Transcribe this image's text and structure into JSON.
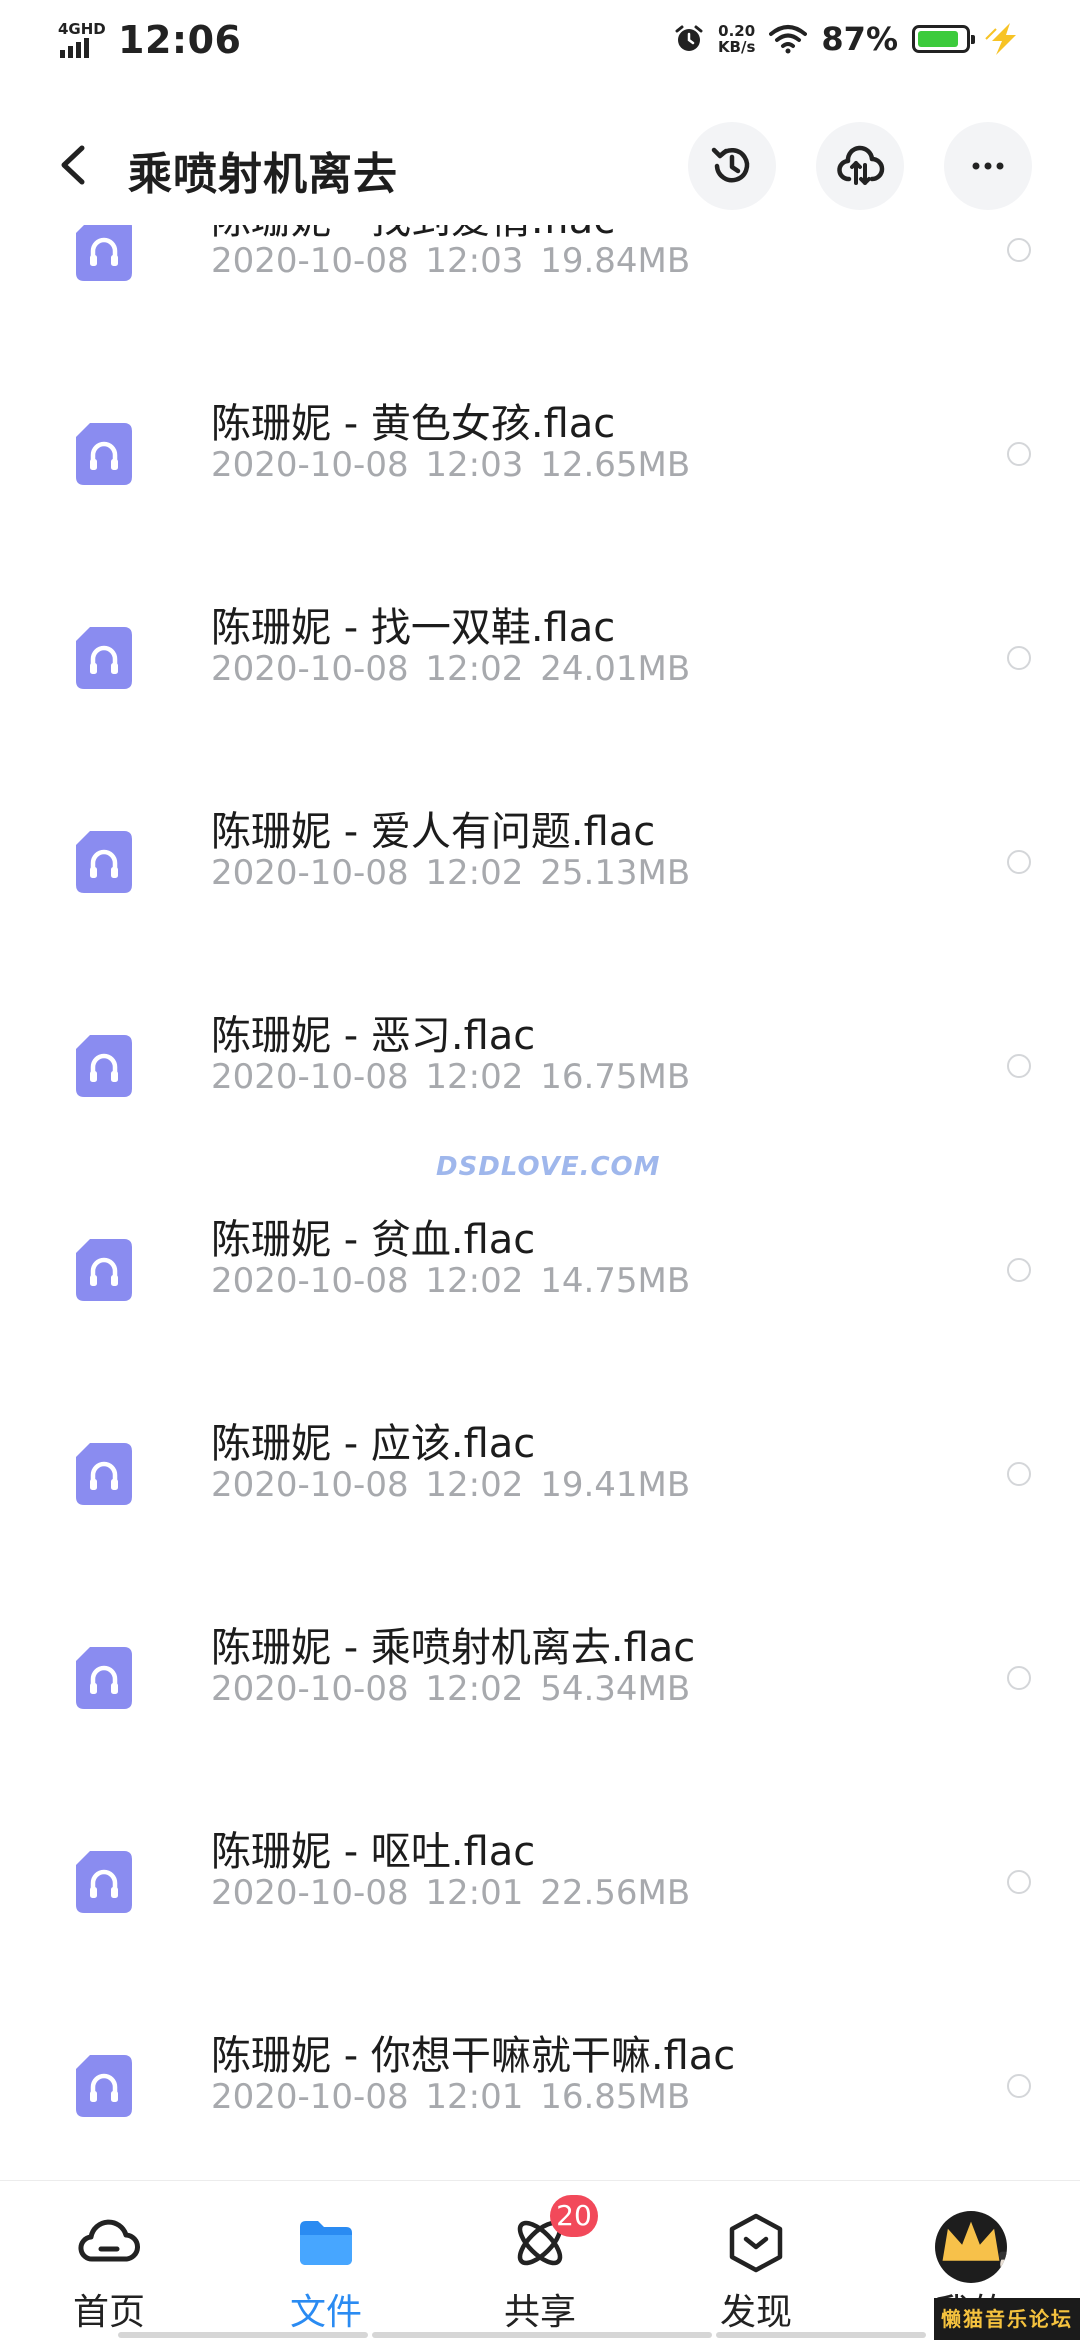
{
  "status_bar": {
    "network_type": "4GHD",
    "time": "12:06",
    "net_speed_value": "0.20",
    "net_speed_unit": "KB/s",
    "battery_percent": "87%",
    "battery_level": 0.87,
    "battery_color": "#3ccb3c"
  },
  "header": {
    "title": "乘喷射机离去",
    "back_icon": "chevron-left-icon",
    "actions": [
      "history-icon",
      "cloud-transfer-icon",
      "more-icon"
    ]
  },
  "files": [
    {
      "name": "陈珊妮 - 找到爱情.flac",
      "meta": "2020-10-08 12:03 19.84MB"
    },
    {
      "name": "陈珊妮 - 黄色女孩.flac",
      "meta": "2020-10-08 12:03 12.65MB"
    },
    {
      "name": "陈珊妮 - 找一双鞋.flac",
      "meta": "2020-10-08 12:02 24.01MB"
    },
    {
      "name": "陈珊妮 - 爱人有问题.flac",
      "meta": "2020-10-08 12:02 25.13MB"
    },
    {
      "name": "陈珊妮 - 恶习.flac",
      "meta": "2020-10-08 12:02 16.75MB"
    },
    {
      "name": "陈珊妮 - 贫血.flac",
      "meta": "2020-10-08 12:02 14.75MB"
    },
    {
      "name": "陈珊妮 - 应该.flac",
      "meta": "2020-10-08 12:02 19.41MB"
    },
    {
      "name": "陈珊妮 - 乘喷射机离去.flac",
      "meta": "2020-10-08 12:02 54.34MB"
    },
    {
      "name": "陈珊妮 - 呕吐.flac",
      "meta": "2020-10-08 12:01 22.56MB"
    },
    {
      "name": "陈珊妮 - 你想干嘛就干嘛.flac",
      "meta": "2020-10-08 12:01 16.85MB"
    }
  ],
  "watermark": "DSDLOVE.COM",
  "bottom_nav": [
    {
      "label": "首页",
      "icon": "cloud-home-icon",
      "active": false
    },
    {
      "label": "文件",
      "icon": "folder-icon",
      "active": true
    },
    {
      "label": "共享",
      "icon": "share-atom-icon",
      "active": false,
      "badge": "20"
    },
    {
      "label": "发现",
      "icon": "discover-box-icon",
      "active": false
    },
    {
      "label": "我的",
      "icon": "avatar",
      "active": false
    }
  ],
  "forum_stamp": "懒猫音乐论坛",
  "colors": {
    "accent": "#2a8bf2",
    "file_icon": "#8a8cf0",
    "badge": "#f2495a",
    "meta_text": "#a7a9ad"
  }
}
